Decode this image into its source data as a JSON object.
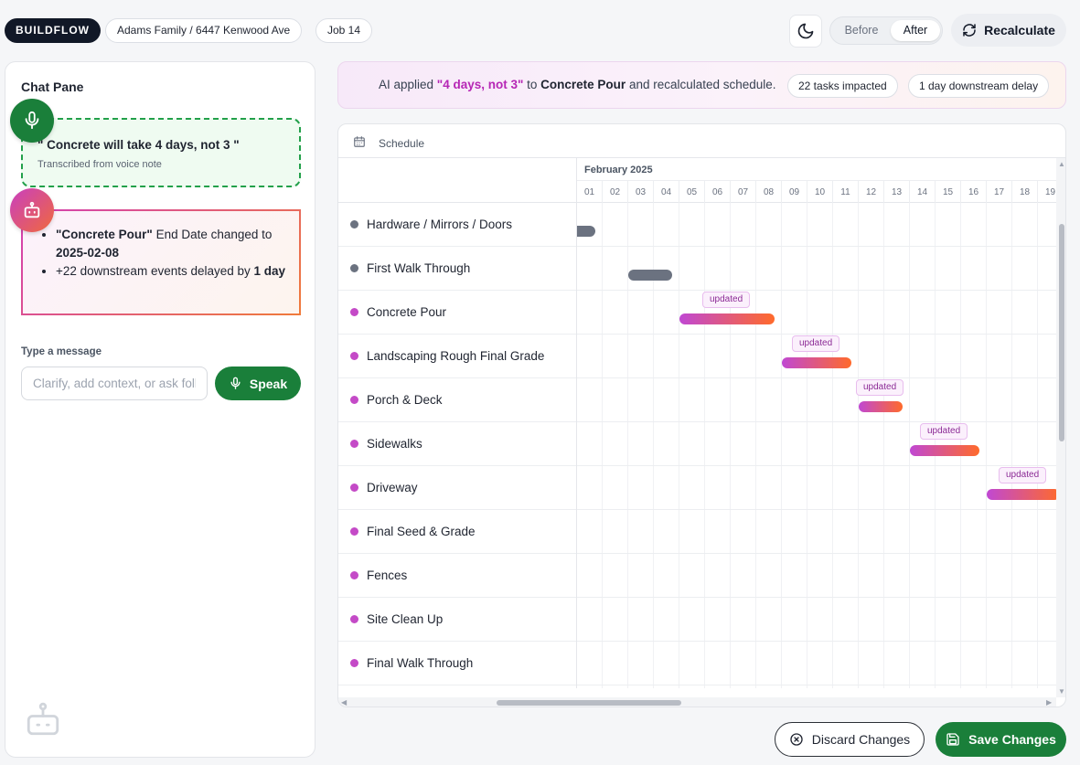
{
  "header": {
    "brand": "BUILDFLOW",
    "project": "Adams Family / 6447 Kenwood Ave",
    "job": "Job 14",
    "toggle_before": "Before",
    "toggle_after": "After",
    "toggle_selected": "After",
    "recalculate_label": "Recalculate"
  },
  "chat": {
    "title": "Chat Pane",
    "voice_note": {
      "quote": "\" Concrete will take 4 days, not 3 \"",
      "caption": "Transcribed from voice note"
    },
    "ai_summary": {
      "item1_task": "\"Concrete Pour\"",
      "item1_mid": " End Date changed to ",
      "item1_date": "2025-02-08",
      "item2_prefix": "+22",
      "item2_mid": " downstream events delayed by ",
      "item2_value": "1 day"
    },
    "input_label": "Type a message",
    "input_placeholder": "Clarify, add context, or ask follow-ups",
    "speak_label": "Speak"
  },
  "banner": {
    "prefix": "AI applied ",
    "change": "\"4 days, not 3\"",
    "to": " to ",
    "task": "Concrete Pour",
    "suffix": " and recalculated schedule.",
    "impacted": "22 tasks impacted",
    "delay": "1 day downstream delay"
  },
  "schedule": {
    "title": "Schedule",
    "month": "February 2025",
    "days": [
      "01",
      "02",
      "03",
      "04",
      "05",
      "06",
      "07",
      "08",
      "09",
      "10",
      "11",
      "12",
      "13",
      "14",
      "15",
      "16",
      "17",
      "18",
      "19"
    ],
    "updated_label": "updated",
    "tasks": [
      {
        "name": "Hardware / Mirrors / Doors",
        "color": "#6b7280",
        "updated": false
      },
      {
        "name": "First Walk Through",
        "color": "#6b7280",
        "updated": false
      },
      {
        "name": "Concrete Pour",
        "color": "#c44ac7",
        "updated": true
      },
      {
        "name": "Landscaping Rough Final Grade",
        "color": "#c44ac7",
        "updated": true
      },
      {
        "name": "Porch & Deck",
        "color": "#c44ac7",
        "updated": true
      },
      {
        "name": "Sidewalks",
        "color": "#c44ac7",
        "updated": true
      },
      {
        "name": "Driveway",
        "color": "#c44ac7",
        "updated": true
      },
      {
        "name": "Final Seed & Grade",
        "color": "#c44ac7",
        "updated": false
      },
      {
        "name": "Fences",
        "color": "#c44ac7",
        "updated": false
      },
      {
        "name": "Site Clean Up",
        "color": "#c44ac7",
        "updated": false
      },
      {
        "name": "Final Walk Through",
        "color": "#c44ac7",
        "updated": false
      }
    ]
  },
  "footer": {
    "discard_label": "Discard Changes",
    "save_label": "Save Changes"
  },
  "colors": {
    "brand_dark": "#111827",
    "primary_green": "#1a7f3a",
    "accent_pink": "#b626b5",
    "accent_orange": "#ff6a2b"
  }
}
